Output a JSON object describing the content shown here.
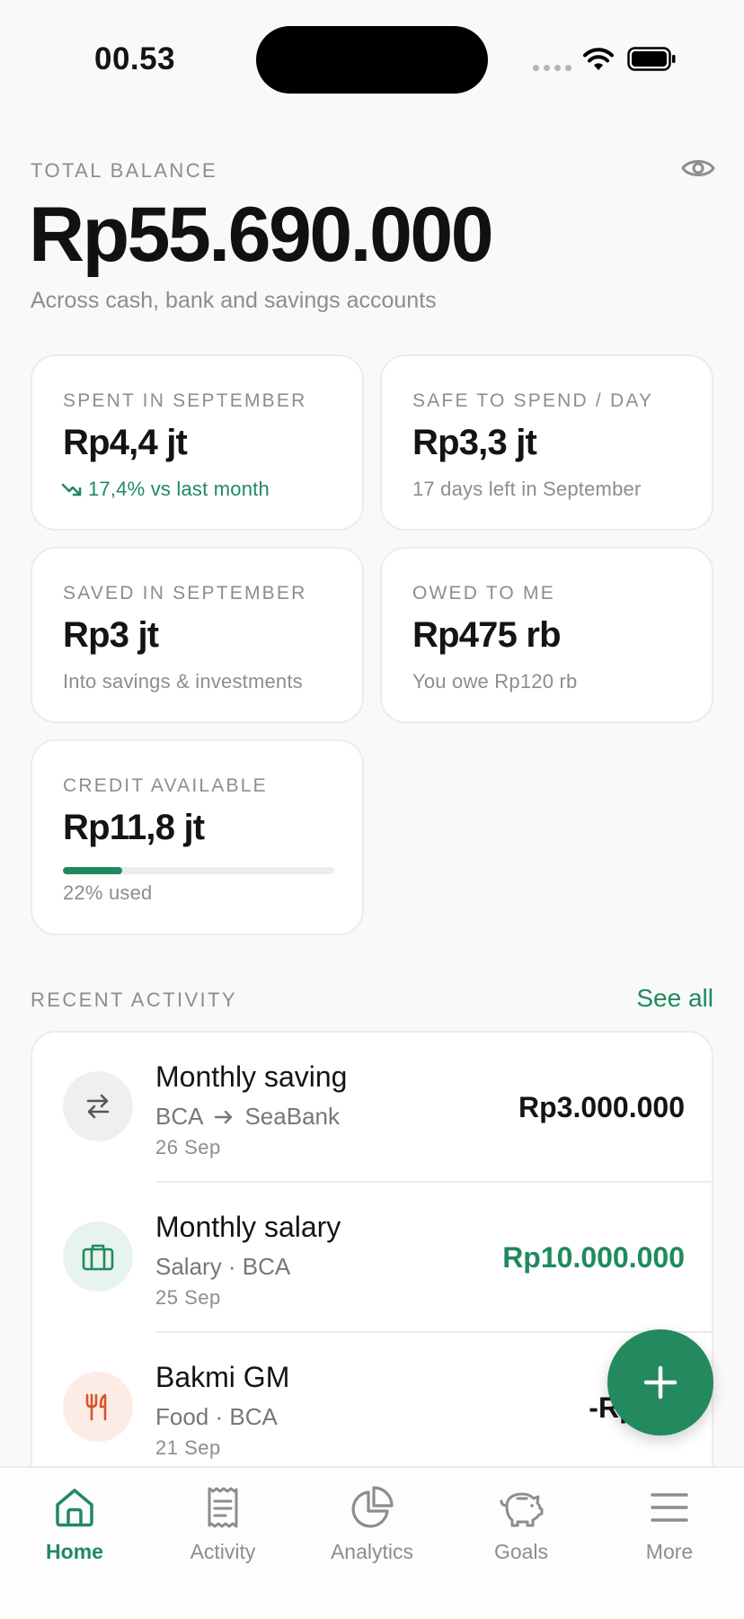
{
  "status_bar": {
    "time": "00.53"
  },
  "balance": {
    "label": "TOTAL BALANCE",
    "amount": "Rp55.690.000",
    "subtitle": "Across cash, bank and savings accounts"
  },
  "cards": {
    "spent": {
      "label": "SPENT IN SEPTEMBER",
      "value": "Rp4,4 jt",
      "sub": "17,4% vs last month"
    },
    "safe": {
      "label": "SAFE TO SPEND / DAY",
      "value": "Rp3,3 jt",
      "sub": "17 days left in September"
    },
    "saved": {
      "label": "SAVED IN SEPTEMBER",
      "value": "Rp3 jt",
      "sub": "Into savings & investments"
    },
    "owed": {
      "label": "OWED TO ME",
      "value": "Rp475 rb",
      "sub": "You owe Rp120 rb"
    },
    "credit": {
      "label": "CREDIT AVAILABLE",
      "value": "Rp11,8 jt",
      "used_fraction": 0.22,
      "sub": "22% used"
    }
  },
  "activity": {
    "label": "RECENT ACTIVITY",
    "see_all": "See all",
    "items": [
      {
        "title": "Monthly saving",
        "from": "BCA",
        "to": "SeaBank",
        "date": "26 Sep",
        "amount": "Rp3.000.000",
        "icon": "transfer-icon"
      },
      {
        "title": "Monthly salary",
        "meta": "Salary · BCA",
        "date": "25 Sep",
        "amount": "Rp10.000.000",
        "icon": "briefcase-icon"
      },
      {
        "title": "Bakmi GM",
        "meta": "Food · BCA",
        "date": "21 Sep",
        "amount": "-Rp210",
        "icon": "fork-knife-icon"
      }
    ]
  },
  "nav": {
    "home": "Home",
    "activity": "Activity",
    "analytics": "Analytics",
    "goals": "Goals",
    "more": "More"
  },
  "colors": {
    "accent": "#1f8a5e",
    "expense_icon_bg": "#fdece6",
    "expense_icon": "#d9532e",
    "income_icon_bg": "#e7f3ee",
    "transfer_icon_bg": "#efefef"
  }
}
